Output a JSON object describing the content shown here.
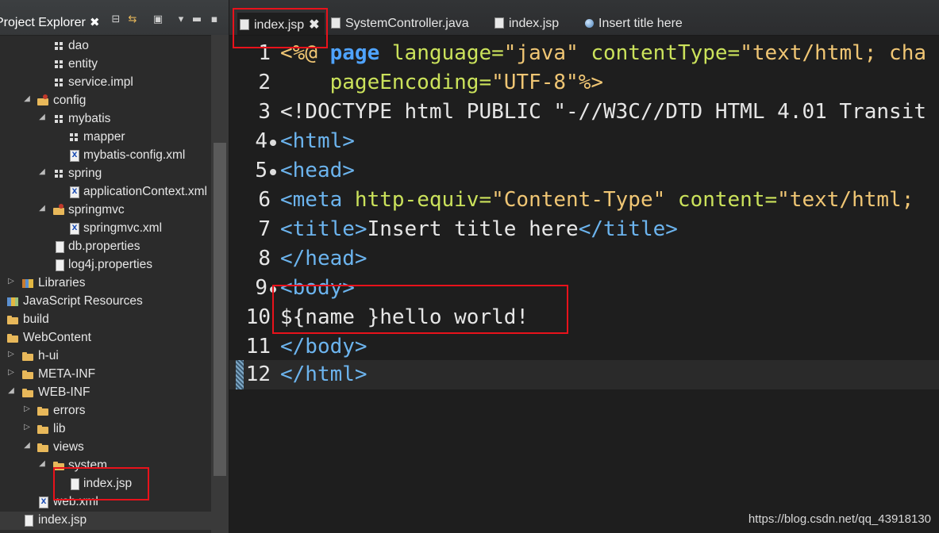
{
  "explorer": {
    "title": "Project Explorer",
    "close_glyph": "✖",
    "toolbar": [
      "collapse-all-icon",
      "link-editor-icon",
      "focus-icon",
      "view-menu-icon",
      "minimize-icon",
      "maximize-icon"
    ],
    "items": [
      {
        "label": "dao",
        "icon": "package-icon",
        "twisty": ""
      },
      {
        "label": "entity",
        "icon": "package-icon",
        "twisty": ""
      },
      {
        "label": "service.impl",
        "icon": "package-icon",
        "twisty": ""
      },
      {
        "label": "config",
        "icon": "source-folder-icon",
        "twisty": "expanded"
      },
      {
        "label": "mybatis",
        "icon": "package-icon",
        "twisty": "expanded"
      },
      {
        "label": "mapper",
        "icon": "package-icon",
        "twisty": ""
      },
      {
        "label": "mybatis-config.xml",
        "icon": "xml-file-icon",
        "twisty": ""
      },
      {
        "label": "spring",
        "icon": "package-icon",
        "twisty": "expanded"
      },
      {
        "label": "applicationContext.xml",
        "icon": "xml-file-icon",
        "twisty": ""
      },
      {
        "label": "springmvc",
        "icon": "source-folder-icon",
        "twisty": "expanded"
      },
      {
        "label": "springmvc.xml",
        "icon": "xml-file-icon",
        "twisty": ""
      },
      {
        "label": "db.properties",
        "icon": "file-icon",
        "twisty": ""
      },
      {
        "label": "log4j.properties",
        "icon": "file-icon",
        "twisty": ""
      },
      {
        "label": "Libraries",
        "icon": "library-icon",
        "twisty": "collapsed"
      },
      {
        "label": "JavaScript Resources",
        "icon": "js-resources-icon",
        "twisty": ""
      },
      {
        "label": "build",
        "icon": "folder-icon",
        "twisty": ""
      },
      {
        "label": "WebContent",
        "icon": "folder-icon",
        "twisty": ""
      },
      {
        "label": "h-ui",
        "icon": "folder-icon",
        "twisty": "collapsed"
      },
      {
        "label": "META-INF",
        "icon": "folder-icon",
        "twisty": "collapsed"
      },
      {
        "label": "WEB-INF",
        "icon": "folder-icon",
        "twisty": "expanded"
      },
      {
        "label": "errors",
        "icon": "folder-icon",
        "twisty": "collapsed"
      },
      {
        "label": "lib",
        "icon": "folder-icon",
        "twisty": "collapsed"
      },
      {
        "label": "views",
        "icon": "folder-icon",
        "twisty": "expanded"
      },
      {
        "label": "system",
        "icon": "folder-icon",
        "twisty": "expanded"
      },
      {
        "label": "index.jsp",
        "icon": "jsp-file-icon",
        "twisty": ""
      },
      {
        "label": "web.xml",
        "icon": "xml-file-icon",
        "twisty": ""
      },
      {
        "label": "index.jsp",
        "icon": "jsp-file-icon",
        "twisty": ""
      }
    ]
  },
  "editor_tabs": [
    {
      "label": "index.jsp",
      "close": "✖"
    },
    {
      "label": "SystemController.java"
    },
    {
      "label": "index.jsp"
    },
    {
      "label": "Insert title here"
    }
  ],
  "code_lines": [
    {
      "n": "1"
    },
    {
      "n": "2"
    },
    {
      "n": "3"
    },
    {
      "n": "4"
    },
    {
      "n": "5"
    },
    {
      "n": "6"
    },
    {
      "n": "7"
    },
    {
      "n": "8"
    },
    {
      "n": "9"
    },
    {
      "n": "10"
    },
    {
      "n": "11"
    },
    {
      "n": "12"
    }
  ],
  "code": {
    "l1": [
      "<%@ ",
      "page",
      " language=",
      "\"java\"",
      " contentType=",
      "\"text/html; cha"
    ],
    "l2": [
      "    pageEncoding=",
      "\"UTF-8\"",
      "%>"
    ],
    "l3": "<!DOCTYPE html PUBLIC \"-//W3C//DTD HTML 4.01 Transit",
    "l4": [
      "<html>"
    ],
    "l5": [
      "<head>"
    ],
    "l6": [
      "<meta ",
      "http-equiv=",
      "\"Content-Type\"",
      " content=",
      "\"text/html;"
    ],
    "l7": [
      "<title>",
      "Insert title here",
      "</title>"
    ],
    "l8": [
      "</head>"
    ],
    "l9": [
      "<body>"
    ],
    "l10": "${name }hello world!",
    "l11": [
      "</body>"
    ],
    "l12": [
      "</html>"
    ]
  },
  "watermark": "https://blog.csdn.net/qq_43918130",
  "colors": {
    "highlight": "#e8121b",
    "tag": "#6cb4ee",
    "attribute": "#cbe25b",
    "string": "#f0c674"
  }
}
